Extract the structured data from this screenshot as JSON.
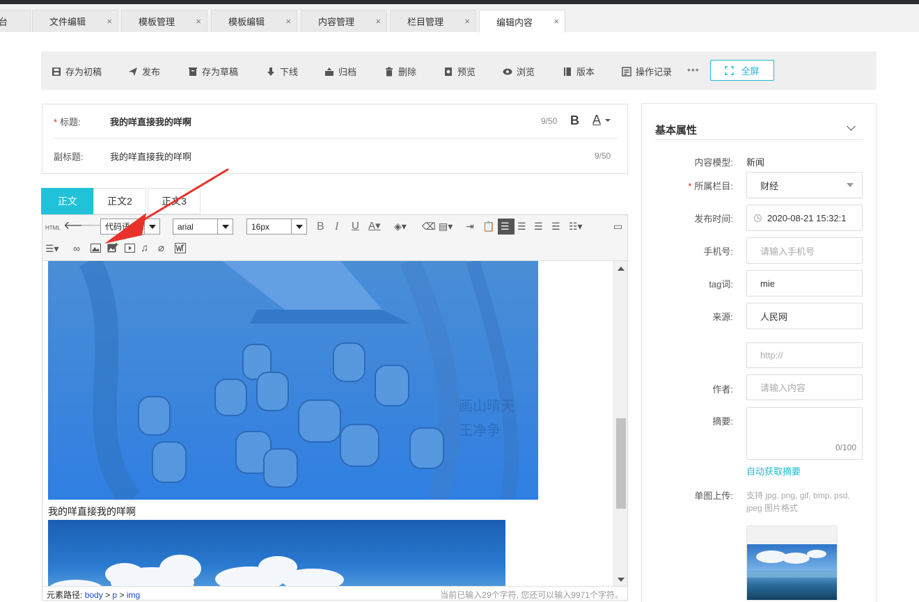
{
  "tabs": [
    {
      "label": "作台",
      "close": "×"
    },
    {
      "label": "文件编辑",
      "close": "×"
    },
    {
      "label": "模板管理",
      "close": "×"
    },
    {
      "label": "模板编辑",
      "close": "×"
    },
    {
      "label": "内容管理",
      "close": "×"
    },
    {
      "label": "栏目管理",
      "close": "×"
    },
    {
      "label": "编辑内容",
      "close": "×"
    }
  ],
  "toolbar": {
    "save_initial": "存为初稿",
    "publish": "发布",
    "save_draft": "存为草稿",
    "offline": "下线",
    "archive": "归档",
    "delete": "删除",
    "preview": "预览",
    "browse": "浏览",
    "version": "版本",
    "history": "操作记录",
    "more": "•••",
    "fullscreen": "全屏"
  },
  "title_form": {
    "title_label": "标题:",
    "title_required": "*",
    "title_value": "我的咩直接我的咩啊",
    "title_count": "9/50",
    "bold": "B",
    "color": "A",
    "subtitle_label": "副标题:",
    "subtitle_value": "我的咩直接我的咩啊",
    "subtitle_count": "9/50"
  },
  "content_tabs": [
    "正文",
    "正文2",
    "正文3"
  ],
  "editor": {
    "html_label": "HTML",
    "lang_select": "代码语言",
    "font_select": "arial",
    "size_select": "16px",
    "caption": "我的咩直接我的咩啊",
    "path_label": "元素路径:",
    "path_body": "body",
    "path_sep1": ">",
    "path_p": "p",
    "path_sep2": ">",
    "path_img": "img",
    "char_count": "当前已输入29个字符, 您还可以输入9971个字符。",
    "image_watermark_1": "画山晴天",
    "image_watermark_2": "王净争"
  },
  "panel": {
    "title": "基本属性",
    "model_label": "内容模型:",
    "model_value": "新闻",
    "column_label": "所属栏目:",
    "column_required": "*",
    "column_value": "财经",
    "time_label": "发布时间:",
    "time_value": "2020-08-21 15:32:1",
    "phone_label": "手机号:",
    "phone_placeholder": "请输入手机号",
    "tag_label": "tag词:",
    "tag_value": "mie",
    "source_label": "来源:",
    "source_value": "人民网",
    "url_placeholder": "http://",
    "author_label": "作者:",
    "author_placeholder": "请输入内容",
    "summary_label": "摘要:",
    "summary_count": "0/100",
    "auto_summary": "自动获取摘要",
    "upload_label": "单图上传:",
    "upload_tip": "支持 jpg, png, gif, bmp, psd, jpeg 图片格式"
  },
  "colors": {
    "accent": "#21c2d9",
    "annotation_arrow": "#e8312a",
    "image_blue": "#3e86db"
  }
}
